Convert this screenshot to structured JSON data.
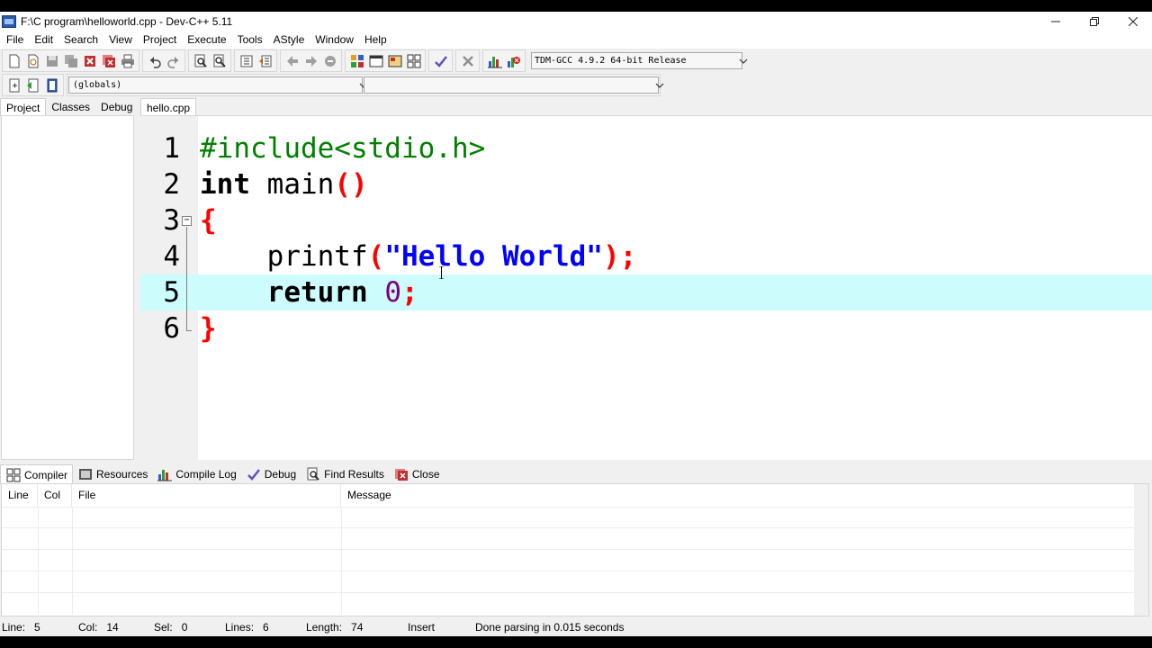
{
  "window": {
    "title": "F:\\C program\\helloworld.cpp - Dev-C++ 5.11"
  },
  "menu": [
    "File",
    "Edit",
    "Search",
    "View",
    "Project",
    "Execute",
    "Tools",
    "AStyle",
    "Window",
    "Help"
  ],
  "toolbar": {
    "compiler": "TDM-GCC 4.9.2 64-bit Release",
    "scope": "(globals)",
    "member": ""
  },
  "left_tabs": [
    "Project",
    "Classes",
    "Debug"
  ],
  "editor": {
    "tab": "hello.cpp",
    "current_line": 5,
    "lines": [
      {
        "n": "1",
        "tokens": [
          [
            "pp",
            "#include<stdio.h>"
          ]
        ]
      },
      {
        "n": "2",
        "tokens": [
          [
            "kw",
            "int"
          ],
          [
            "",
            " main"
          ],
          [
            "sym",
            "()"
          ]
        ]
      },
      {
        "n": "3",
        "tokens": [
          [
            "sym",
            "{"
          ]
        ]
      },
      {
        "n": "4",
        "tokens": [
          [
            "",
            "    printf"
          ],
          [
            "sym",
            "("
          ],
          [
            "str",
            "\"Hello World\""
          ],
          [
            "sym",
            ");"
          ]
        ]
      },
      {
        "n": "5",
        "tokens": [
          [
            "",
            "    "
          ],
          [
            "kw",
            "return"
          ],
          [
            "",
            " "
          ],
          [
            "num",
            "0"
          ],
          [
            "sym",
            ";"
          ]
        ]
      },
      {
        "n": "6",
        "tokens": [
          [
            "sym",
            "}"
          ]
        ]
      }
    ]
  },
  "bottom_tabs": [
    "Compiler",
    "Resources",
    "Compile Log",
    "Debug",
    "Find Results",
    "Close"
  ],
  "compiler_columns": [
    "Line",
    "Col",
    "File",
    "Message"
  ],
  "status": {
    "line_label": "Line:",
    "line_value": "5",
    "col_label": "Col:",
    "col_value": "14",
    "sel_label": "Sel:",
    "sel_value": "0",
    "lines_label": "Lines:",
    "lines_value": "6",
    "length_label": "Length:",
    "length_value": "74",
    "mode": "Insert",
    "message": "Done parsing in 0.015 seconds"
  },
  "colors": {
    "current_line_bg": "#ccfcfc",
    "preprocessor": "#008000",
    "symbol": "#ff0000",
    "string": "#0000ff",
    "number": "#800080"
  }
}
